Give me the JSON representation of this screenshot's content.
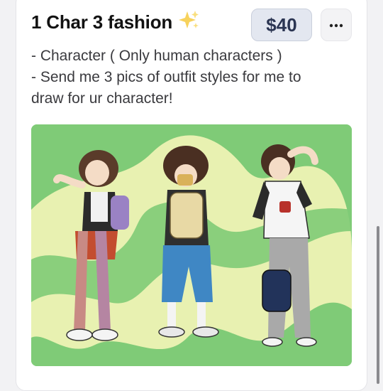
{
  "listing": {
    "title": "1 Char 3 fashion",
    "title_emoji_icon": "sparkles-icon",
    "price": "$40",
    "more_icon": "ellipsis-icon",
    "description_lines": [
      "- Character ( Only human characters )",
      "- Send me 3 pics of outfit styles for me to",
      "draw for ur character!"
    ]
  },
  "colors": {
    "price_badge_bg": "#e3e7f0",
    "price_text": "#2b3552",
    "artwork_green": "#7fcb77",
    "artwork_yellow": "#eef2b4"
  }
}
